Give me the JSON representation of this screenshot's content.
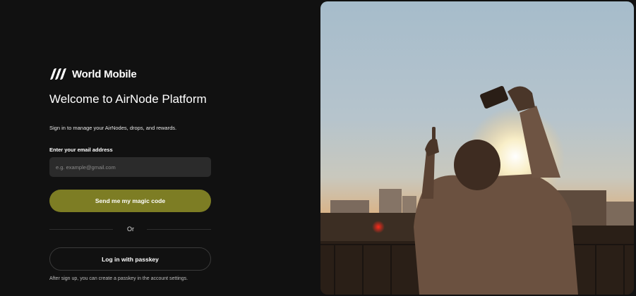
{
  "brand": {
    "logo_icon": "world-mobile-logo-icon",
    "name": "World Mobile"
  },
  "login": {
    "title": "Welcome to AirNode Platform",
    "subtitle": "Sign in to manage your AirNodes, drops, and rewards.",
    "email_label": "Enter your email address",
    "email_placeholder": "e.g. example@gmail.com",
    "email_value": "",
    "magic_button": "Send me my magic code",
    "or_text": "Or",
    "passkey_button": "Log in with passkey",
    "footnote": "After sign up, you can create a passkey in the account settings."
  },
  "colors": {
    "background": "#111111",
    "input_background": "#2b2b2b",
    "accent": "#7d7d24",
    "text": "#ffffff"
  }
}
